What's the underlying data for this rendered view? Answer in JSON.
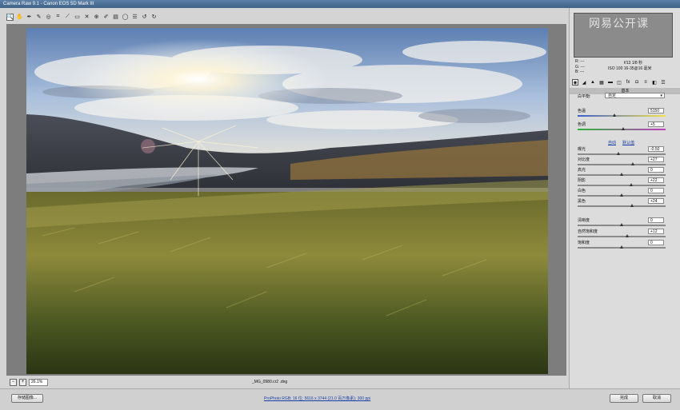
{
  "window": {
    "title": "Camera Raw 9.1  -  Canon EOS 5D Mark III"
  },
  "toolbar": {
    "tools": [
      {
        "name": "zoom-tool",
        "glyph": "🔍"
      },
      {
        "name": "hand-tool",
        "glyph": "✋"
      },
      {
        "name": "white-balance-tool",
        "glyph": "✒"
      },
      {
        "name": "color-sampler-tool",
        "glyph": "✎"
      },
      {
        "name": "targeted-adjustment-tool",
        "glyph": "◎"
      },
      {
        "name": "crop-tool",
        "glyph": "⌗"
      },
      {
        "name": "straighten-tool",
        "glyph": "⟋"
      },
      {
        "name": "transform-tool",
        "glyph": "▭"
      },
      {
        "name": "spot-removal-tool",
        "glyph": "✕"
      },
      {
        "name": "red-eye-tool",
        "glyph": "⊕"
      },
      {
        "name": "adjustment-brush-tool",
        "glyph": "✐"
      },
      {
        "name": "graduated-filter-tool",
        "glyph": "▤"
      },
      {
        "name": "radial-filter-tool",
        "glyph": "◯"
      },
      {
        "name": "preferences-tool",
        "glyph": "☰"
      },
      {
        "name": "rotate-ccw-tool",
        "glyph": "↺"
      },
      {
        "name": "rotate-cw-tool",
        "glyph": "↻"
      }
    ]
  },
  "histogram": {
    "watermark": "网易公开课"
  },
  "readout": {
    "r": "R:  ---",
    "g": "G:  ---",
    "b": "B:  ---",
    "camera_line1": "f/13   1/8 秒",
    "camera_line2": "ISO 100   16-35@16 毫米"
  },
  "panel": {
    "section_title": "基本",
    "wb_label": "白平衡:",
    "wb_value": "自定",
    "links": {
      "auto": "自动",
      "default": "默认值"
    },
    "controls": [
      {
        "label": "色温",
        "value": "5150",
        "pos": 0.42
      },
      {
        "label": "色调",
        "value": "+5",
        "pos": 0.52
      },
      {
        "label": "曝光",
        "value": "-0.50",
        "pos": 0.46
      },
      {
        "label": "对比度",
        "value": "+27",
        "pos": 0.63
      },
      {
        "label": "高光",
        "value": "0",
        "pos": 0.5
      },
      {
        "label": "阴影",
        "value": "+22",
        "pos": 0.61
      },
      {
        "label": "白色",
        "value": "0",
        "pos": 0.5
      },
      {
        "label": "黑色",
        "value": "+24",
        "pos": 0.62
      },
      {
        "label": "清晰度",
        "value": "0",
        "pos": 0.5
      },
      {
        "label": "自然饱和度",
        "value": "+12",
        "pos": 0.56
      },
      {
        "label": "饱和度",
        "value": "0",
        "pos": 0.5
      }
    ]
  },
  "status": {
    "zoom": "26.1%",
    "filename": "_MG_0980.cr2 .dng"
  },
  "bottom": {
    "save_label": "存储图像...",
    "workflow_link": "ProPhoto RGB; 16 位; 5616 x 3744 (21.0 百万像素); 300 ppi",
    "done_label": "完成",
    "cancel_label": "取消"
  }
}
